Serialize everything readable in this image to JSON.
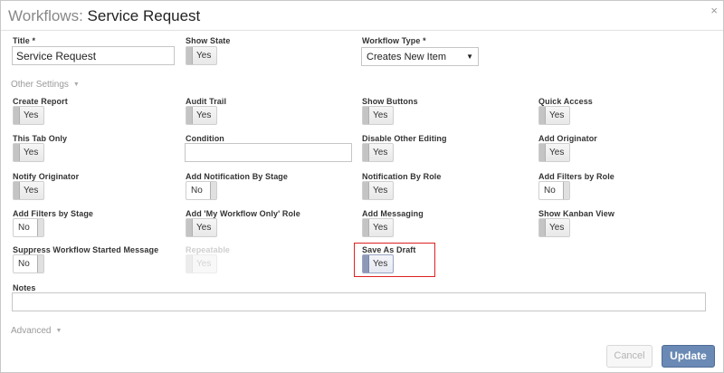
{
  "header": {
    "prefix": "Workflows:",
    "title": "Service Request",
    "close": "×"
  },
  "title_field": {
    "label": "Title *",
    "value": "Service Request"
  },
  "show_state": {
    "label": "Show State",
    "value": "Yes"
  },
  "workflow_type": {
    "label": "Workflow Type *",
    "value": "Creates New Item",
    "arrow": "▼"
  },
  "other_settings": {
    "label": "Other Settings",
    "caret": "▼"
  },
  "settings": {
    "create_report": {
      "label": "Create Report",
      "value": "Yes"
    },
    "audit_trail": {
      "label": "Audit Trail",
      "value": "Yes"
    },
    "show_buttons": {
      "label": "Show Buttons",
      "value": "Yes"
    },
    "quick_access": {
      "label": "Quick Access",
      "value": "Yes"
    },
    "this_tab_only": {
      "label": "This Tab Only",
      "value": "Yes"
    },
    "condition": {
      "label": "Condition",
      "value": ""
    },
    "disable_other_editing": {
      "label": "Disable Other Editing",
      "value": "Yes"
    },
    "add_originator": {
      "label": "Add Originator",
      "value": "Yes"
    },
    "notify_originator": {
      "label": "Notify Originator",
      "value": "Yes"
    },
    "add_notification_by_stage": {
      "label": "Add Notification By Stage",
      "value": "No"
    },
    "notification_by_role": {
      "label": "Notification By Role",
      "value": "Yes"
    },
    "add_filters_by_role": {
      "label": "Add Filters by Role",
      "value": "No"
    },
    "add_filters_by_stage": {
      "label": "Add Filters by Stage",
      "value": "No"
    },
    "add_my_workflow_only_role": {
      "label": "Add 'My Workflow Only' Role",
      "value": "Yes"
    },
    "add_messaging": {
      "label": "Add Messaging",
      "value": "Yes"
    },
    "show_kanban_view": {
      "label": "Show Kanban View",
      "value": "Yes"
    },
    "suppress_workflow_started_message": {
      "label": "Suppress Workflow Started Message",
      "value": "No"
    },
    "repeatable": {
      "label": "Repeatable",
      "value": "Yes"
    },
    "save_as_draft": {
      "label": "Save As Draft",
      "value": "Yes"
    }
  },
  "notes": {
    "label": "Notes",
    "value": ""
  },
  "advanced": {
    "label": "Advanced",
    "caret": "▼"
  },
  "footer": {
    "cancel": "Cancel",
    "update": "Update"
  }
}
